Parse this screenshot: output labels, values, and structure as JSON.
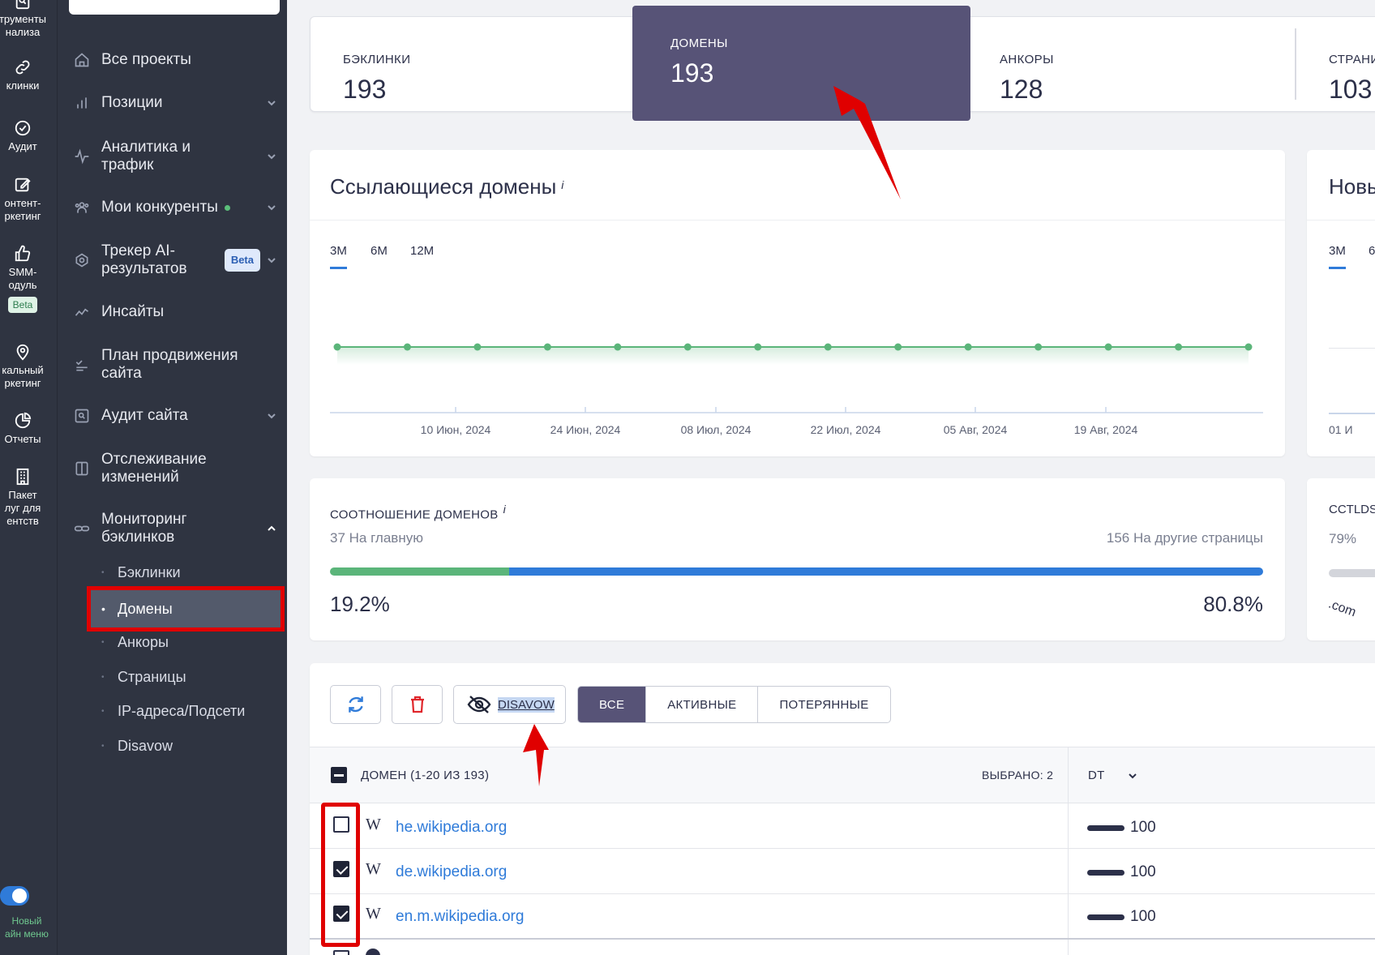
{
  "rail": {
    "items": [
      {
        "label": "трументы\nнализа",
        "icon": "search-doc-icon"
      },
      {
        "label": "клинки",
        "icon": "link-icon"
      },
      {
        "label": "Аудит",
        "icon": "check-circle-icon"
      },
      {
        "label": "онтент-\nркетинг",
        "icon": "edit-icon"
      },
      {
        "label": "SMM-\nодуль",
        "icon": "thumbs-up-icon",
        "badge": "Beta"
      },
      {
        "label": "кальный\nркетинг",
        "icon": "map-pin-icon"
      },
      {
        "label": "Отчеты",
        "icon": "pie-chart-icon"
      },
      {
        "label": "Пакет\nлуг для\nентств",
        "icon": "building-icon"
      }
    ],
    "toggle_label": "Новый\nайн меню"
  },
  "nav": {
    "items": [
      {
        "label": "Все проекты",
        "icon": "home-icon"
      },
      {
        "label": "Позиции",
        "icon": "bar-chart-icon"
      },
      {
        "label": "Аналитика и\nтрафик",
        "icon": "pulse-icon"
      },
      {
        "label": "Мои конкуренты",
        "icon": "users-icon"
      },
      {
        "label": "Трекер AI-\nрезультатов",
        "icon": "ai-icon",
        "badge": "Beta"
      },
      {
        "label": "Инсайты",
        "icon": "trend-icon"
      },
      {
        "label": "План продвижения\nсайта",
        "icon": "checklist-icon"
      },
      {
        "label": "Аудит сайта",
        "icon": "audit-icon"
      },
      {
        "label": "Отслеживание\nизменений",
        "icon": "compare-icon"
      },
      {
        "label": "Мониторинг\nбэклинков",
        "icon": "chain-icon"
      }
    ],
    "sub_items": [
      "Бэклинки",
      "Домены",
      "Анкоры",
      "Страницы",
      "IP-адреса/Подсети",
      "Disavow"
    ]
  },
  "stats": [
    {
      "label": "БЭКЛИНКИ",
      "value": "193"
    },
    {
      "label": "ДОМЕНЫ",
      "value": "193"
    },
    {
      "label": "АНКОРЫ",
      "value": "128"
    },
    {
      "label": "СТРАНИ",
      "value": "103"
    }
  ],
  "domains_chart": {
    "title": "Ссылающиеся домены",
    "info": "i",
    "tabs": [
      "3M",
      "6M",
      "12M"
    ],
    "active_tab": "3M"
  },
  "chart_data": {
    "type": "line",
    "title": "Ссылающиеся домены",
    "x": [
      "10 Июн, 2024",
      "24 Июн, 2024",
      "08 Июл, 2024",
      "22 Июл, 2024",
      "05 Авг, 2024",
      "19 Авг, 2024"
    ],
    "points": 14,
    "series": [
      {
        "values": [
          193,
          193,
          193,
          193,
          193,
          193,
          193,
          193,
          193,
          193,
          193,
          193,
          193,
          193
        ]
      }
    ],
    "color": "#5bb57a",
    "grid": false
  },
  "new_card": {
    "title": "Новы",
    "tabs": [
      "3M",
      "6"
    ],
    "axis_label": "01 И"
  },
  "ratio": {
    "title": "СООТНОШЕНИЕ ДОМЕНОВ",
    "info": "i",
    "left_label": "37 На главную",
    "right_label": "156 На другие страницы",
    "left_pct": "19.2%",
    "right_pct": "80.8%",
    "left_fraction": 0.192,
    "left_color": "#5bb57a",
    "right_color": "#2f7bd9"
  },
  "cctld": {
    "title": "CCTLDS",
    "pct": "79%",
    "tld": ".com"
  },
  "toolbar": {
    "disavow_label": "DISAVOW",
    "filters": [
      "ВСЕ",
      "АКТИВНЫЕ",
      "ПОТЕРЯННЫЕ"
    ],
    "active_filter": "ВСЕ"
  },
  "table": {
    "header_domain": "ДОМЕН (1-20 ИЗ 193)",
    "selected": "ВЫБРАНО: 2",
    "header_dt": "DT",
    "rows": [
      {
        "domain": "he.wikipedia.org",
        "dt": "100",
        "checked": false
      },
      {
        "domain": "de.wikipedia.org",
        "dt": "100",
        "checked": true
      },
      {
        "domain": "en.m.wikipedia.org",
        "dt": "100",
        "checked": true
      }
    ],
    "favicon": "W"
  }
}
